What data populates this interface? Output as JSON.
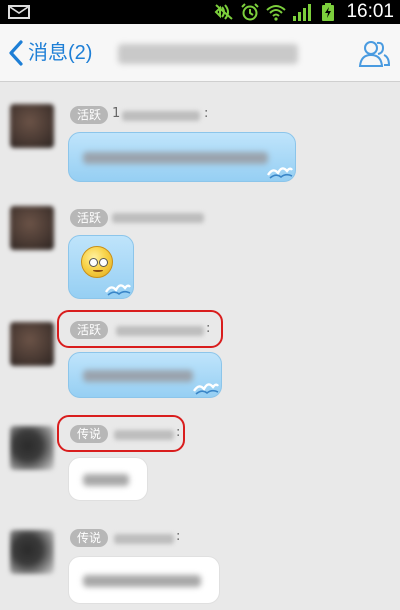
{
  "status_bar": {
    "time": "16:01",
    "icons": [
      "mail-icon",
      "silent-icon",
      "alarm-icon",
      "wifi-icon",
      "signal-icon",
      "battery-charging-icon"
    ]
  },
  "header": {
    "back_label": "消息(2)",
    "back_icon": "chevron-left-icon",
    "members_icon": "group-members-icon"
  },
  "messages": [
    {
      "badge": "活跃",
      "bubble": "blue",
      "colon": ":",
      "name_prefix": "1"
    },
    {
      "badge": "活跃",
      "bubble": "blue-emoji"
    },
    {
      "badge": "活跃",
      "bubble": "blue",
      "colon": ":",
      "highlighted": true
    },
    {
      "badge": "传说",
      "bubble": "white",
      "colon": ":",
      "highlighted": true
    },
    {
      "badge": "传说",
      "bubble": "white",
      "colon": ":"
    }
  ],
  "colors": {
    "accent": "#1e7fd6",
    "highlight": "#d91d1d",
    "bubble_blue": "#a9d9f7",
    "badge": "#b7b7b7"
  }
}
